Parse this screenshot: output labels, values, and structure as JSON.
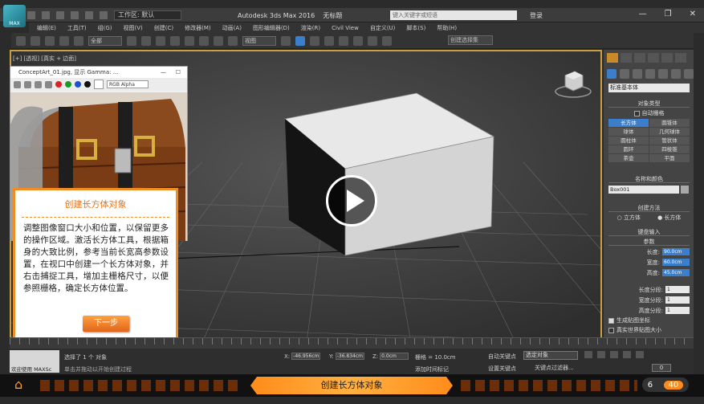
{
  "titlebar": {
    "app_logo": "MAX",
    "workspace": "工作区: 默认",
    "title": "Autodesk 3ds Max 2016",
    "filename": "无标题",
    "search_placeholder": "键入关键字或短语",
    "login": "登录",
    "min": "—",
    "restore": "❐",
    "close": "✕"
  },
  "menu": [
    "编辑(E)",
    "工具(T)",
    "组(G)",
    "视图(V)",
    "创建(C)",
    "修改器(M)",
    "动画(A)",
    "图形编辑器(D)",
    "渲染(R)",
    "Civil View",
    "自定义(U)",
    "脚本(S)",
    "帮助(H)"
  ],
  "toolbar": {
    "filter_select": "全部",
    "view_select": "视图",
    "selection_set_placeholder": "创建选择集"
  },
  "viewport": {
    "label": "[+] [透视] [真实 + 边面]"
  },
  "image_window": {
    "title": "ConceptArt_01.jpg, 显示 Gamma: ...",
    "minimize": "—",
    "maximize": "☐",
    "channel_select": "RGB Alpha",
    "colors": [
      "#e22020",
      "#1a9a2a",
      "#2050d0",
      "#111111",
      "#ffffff"
    ]
  },
  "callout": {
    "title": "创建长方体对象",
    "body": "调整图像窗口大小和位置，以保留更多的操作区域。激活长方体工具，根据箱身的大致比例，参考当前长宽高参数设置，在视口中创建一个长方体对象，并右击捕捉工具，增加主栅格尺寸，以便参照栅格，确定长方体位置。",
    "next_label": "下一步"
  },
  "command_panel": {
    "category_select": "标准基本体",
    "object_type_header": "对象类型",
    "autogrid_label": "自动栅格",
    "object_types": [
      "长方体",
      "圆锥体",
      "球体",
      "几何球体",
      "圆柱体",
      "管状体",
      "圆环",
      "四棱锥",
      "茶壶",
      "平面"
    ],
    "active_object_type": "长方体",
    "name_color_header": "名称和颜色",
    "object_name": "Box001",
    "object_color": "#a8a8a8",
    "creation_method_header": "创建方法",
    "creation_methods": [
      "立方体",
      "长方体"
    ],
    "active_creation_method": "长方体",
    "keyboard_entry_header": "键盘输入",
    "params_header": "参数",
    "length_label": "长度:",
    "length_value": "90.0cm",
    "width_label": "宽度:",
    "width_value": "60.0cm",
    "height_label": "高度:",
    "height_value": "45.0cm",
    "length_segs_label": "长度分段:",
    "length_segs": "1",
    "width_segs_label": "宽度分段:",
    "width_segs": "1",
    "height_segs_label": "高度分段:",
    "height_segs": "1",
    "gen_map_label": "生成贴图坐标",
    "real_world_label": "真实世界贴图大小"
  },
  "status": {
    "maxscript_label": "欢迎使用 MAXSc",
    "selected_text": "选择了 1 个 对象",
    "hint_text": "单击并拖动以开始创建过程",
    "x_label": "X:",
    "x_value": "-46.956cm",
    "y_label": "Y:",
    "y_value": "-36.834cm",
    "z_label": "Z:",
    "z_value": "0.0cm",
    "grid_label": "栅格 = 10.0cm",
    "add_time_tag": "添加时间标记",
    "autokey_label": "自动关键点",
    "selected_object_select": "选定对象",
    "setkey_label": "设置关键点",
    "key_filter_label": "关键点过滤器...",
    "frame_value": "0"
  },
  "bottombar": {
    "caption": "创建长方体对象",
    "page_current": "6",
    "page_total": "40"
  }
}
